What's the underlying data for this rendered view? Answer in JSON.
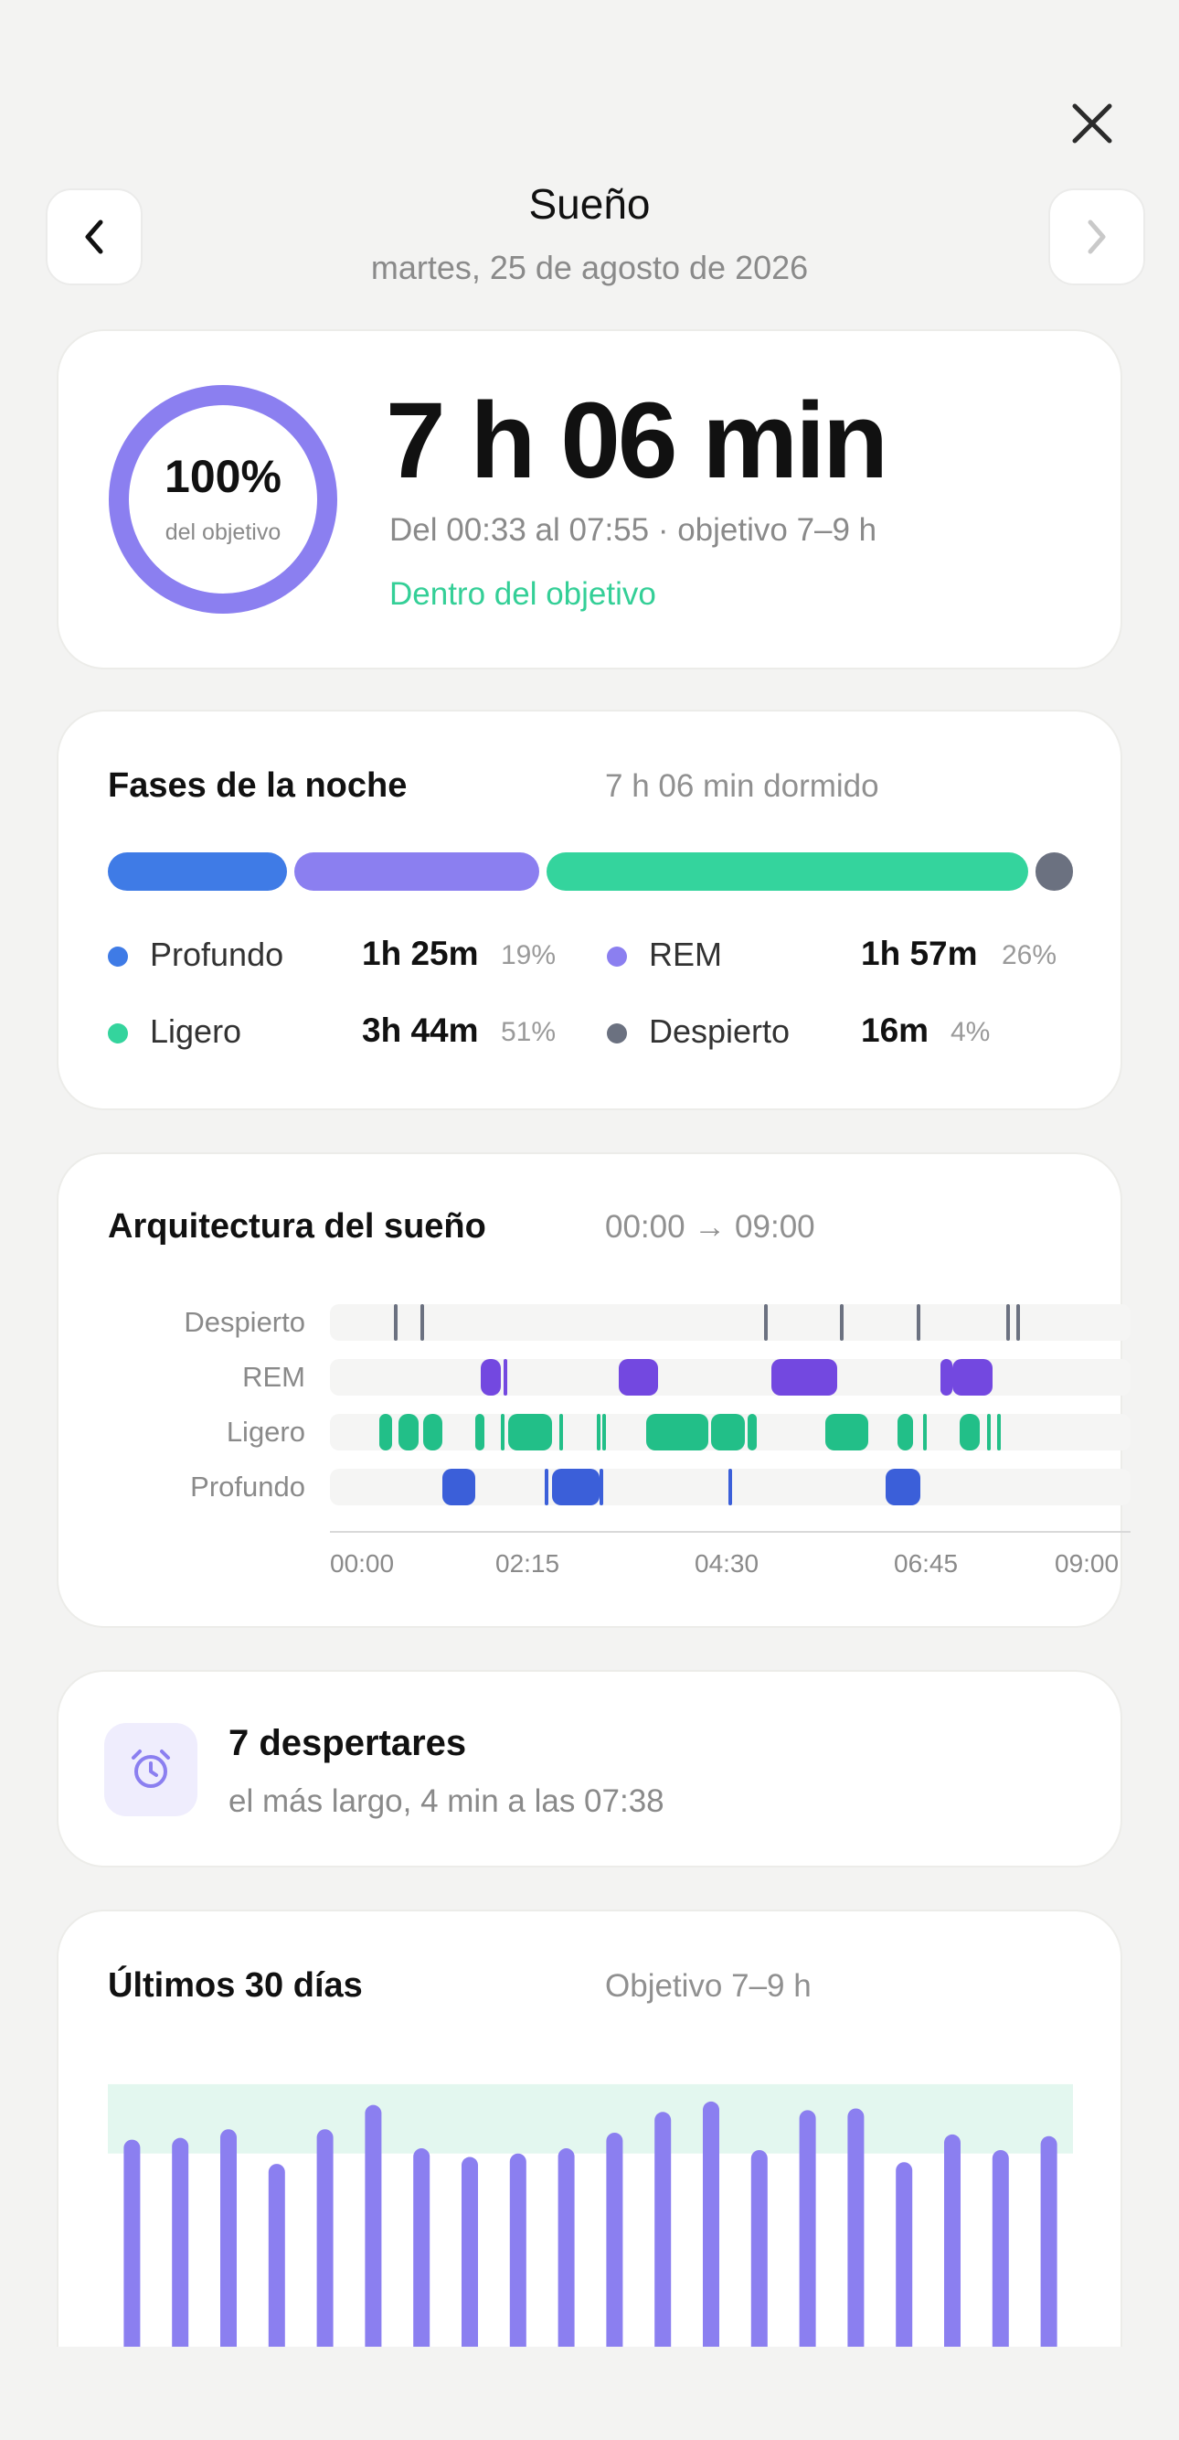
{
  "header": {
    "title": "Sueño",
    "date": "martes, 25 de agosto de 2026",
    "back_icon": "chevron-left-icon",
    "forward_icon": "chevron-right-icon",
    "close_icon": "close-icon"
  },
  "summary": {
    "ring_percent": "100%",
    "ring_label": "del objetivo",
    "ring_fraction": 1.0,
    "duration": "7 h 06 min",
    "range": "Del 00:33 al 07:55 · objetivo 7–9 h",
    "status": "Dentro del objetivo"
  },
  "phases": {
    "title": "Fases de la noche",
    "subtitle": "7 h 06 min dormido",
    "items": [
      {
        "label": "Profundo",
        "value": "1h 25m",
        "pct": "19%",
        "color": "#3f7be6",
        "fraction": 0.19
      },
      {
        "label": "REM",
        "value": "1h 57m",
        "pct": "26%",
        "color": "#8b7ff0",
        "fraction": 0.26
      },
      {
        "label": "Ligero",
        "value": "3h 44m",
        "pct": "51%",
        "color": "#34d49d",
        "fraction": 0.51
      },
      {
        "label": "Despierto",
        "value": "16m",
        "pct": "4%",
        "color": "#6b7180",
        "fraction": 0.04
      }
    ]
  },
  "architecture": {
    "title": "Arquitectura del sueño",
    "range": "00:00 → 09:00",
    "rows": [
      "Despierto",
      "REM",
      "Ligero",
      "Profundo"
    ],
    "ticks": [
      "00:00",
      "02:15",
      "04:30",
      "06:45",
      "09:00"
    ],
    "segments": {
      "Despierto": [
        [
          "00:43",
          "00:45"
        ],
        [
          "01:01",
          "01:03"
        ],
        [
          "04:53",
          "04:55"
        ],
        [
          "05:44",
          "05:46"
        ],
        [
          "06:36",
          "06:38"
        ],
        [
          "07:36",
          "07:38"
        ],
        [
          "07:43",
          "07:45"
        ]
      ],
      "REM": [
        [
          "01:42",
          "01:55"
        ],
        [
          "01:57",
          "02:00"
        ],
        [
          "03:15",
          "03:41"
        ],
        [
          "04:58",
          "05:42"
        ],
        [
          "06:52",
          "07:00"
        ],
        [
          "07:00",
          "07:27"
        ]
      ],
      "Ligero": [
        [
          "00:33",
          "00:42"
        ],
        [
          "00:46",
          "01:00"
        ],
        [
          "01:03",
          "01:16"
        ],
        [
          "01:38",
          "01:44"
        ],
        [
          "01:55",
          "01:57"
        ],
        [
          "02:00",
          "02:30"
        ],
        [
          "02:35",
          "02:37"
        ],
        [
          "03:00",
          "03:03"
        ],
        [
          "03:04",
          "03:08"
        ],
        [
          "03:33",
          "04:15"
        ],
        [
          "04:17",
          "04:40"
        ],
        [
          "04:42",
          "04:48"
        ],
        [
          "05:34",
          "06:03"
        ],
        [
          "06:23",
          "06:33"
        ],
        [
          "06:40",
          "06:43"
        ],
        [
          "07:05",
          "07:18"
        ],
        [
          "07:23",
          "07:26"
        ],
        [
          "07:30",
          "07:33"
        ]
      ],
      "Profundo": [
        [
          "01:16",
          "01:38"
        ],
        [
          "02:25",
          "02:29"
        ],
        [
          "02:30",
          "03:02"
        ],
        [
          "03:02",
          "03:05"
        ],
        [
          "04:29",
          "04:33"
        ],
        [
          "06:15",
          "06:38"
        ]
      ]
    }
  },
  "awakenings": {
    "icon": "alarm-clock-icon",
    "title": "7 despertares",
    "subtitle": "el más largo, 4 min a las 07:38"
  },
  "last30": {
    "title": "Últimos 30 días",
    "subtitle": "Objetivo 7–9 h",
    "goal_hours": [
      7,
      9
    ],
    "y_max_hours": 9.5,
    "values_hours": [
      7.4,
      7.45,
      7.7,
      6.7,
      7.7,
      8.4,
      7.15,
      6.9,
      7.0,
      7.15,
      7.6,
      8.2,
      8.5,
      7.1,
      8.25,
      8.3,
      6.75,
      7.55,
      7.1,
      7.5
    ]
  }
}
